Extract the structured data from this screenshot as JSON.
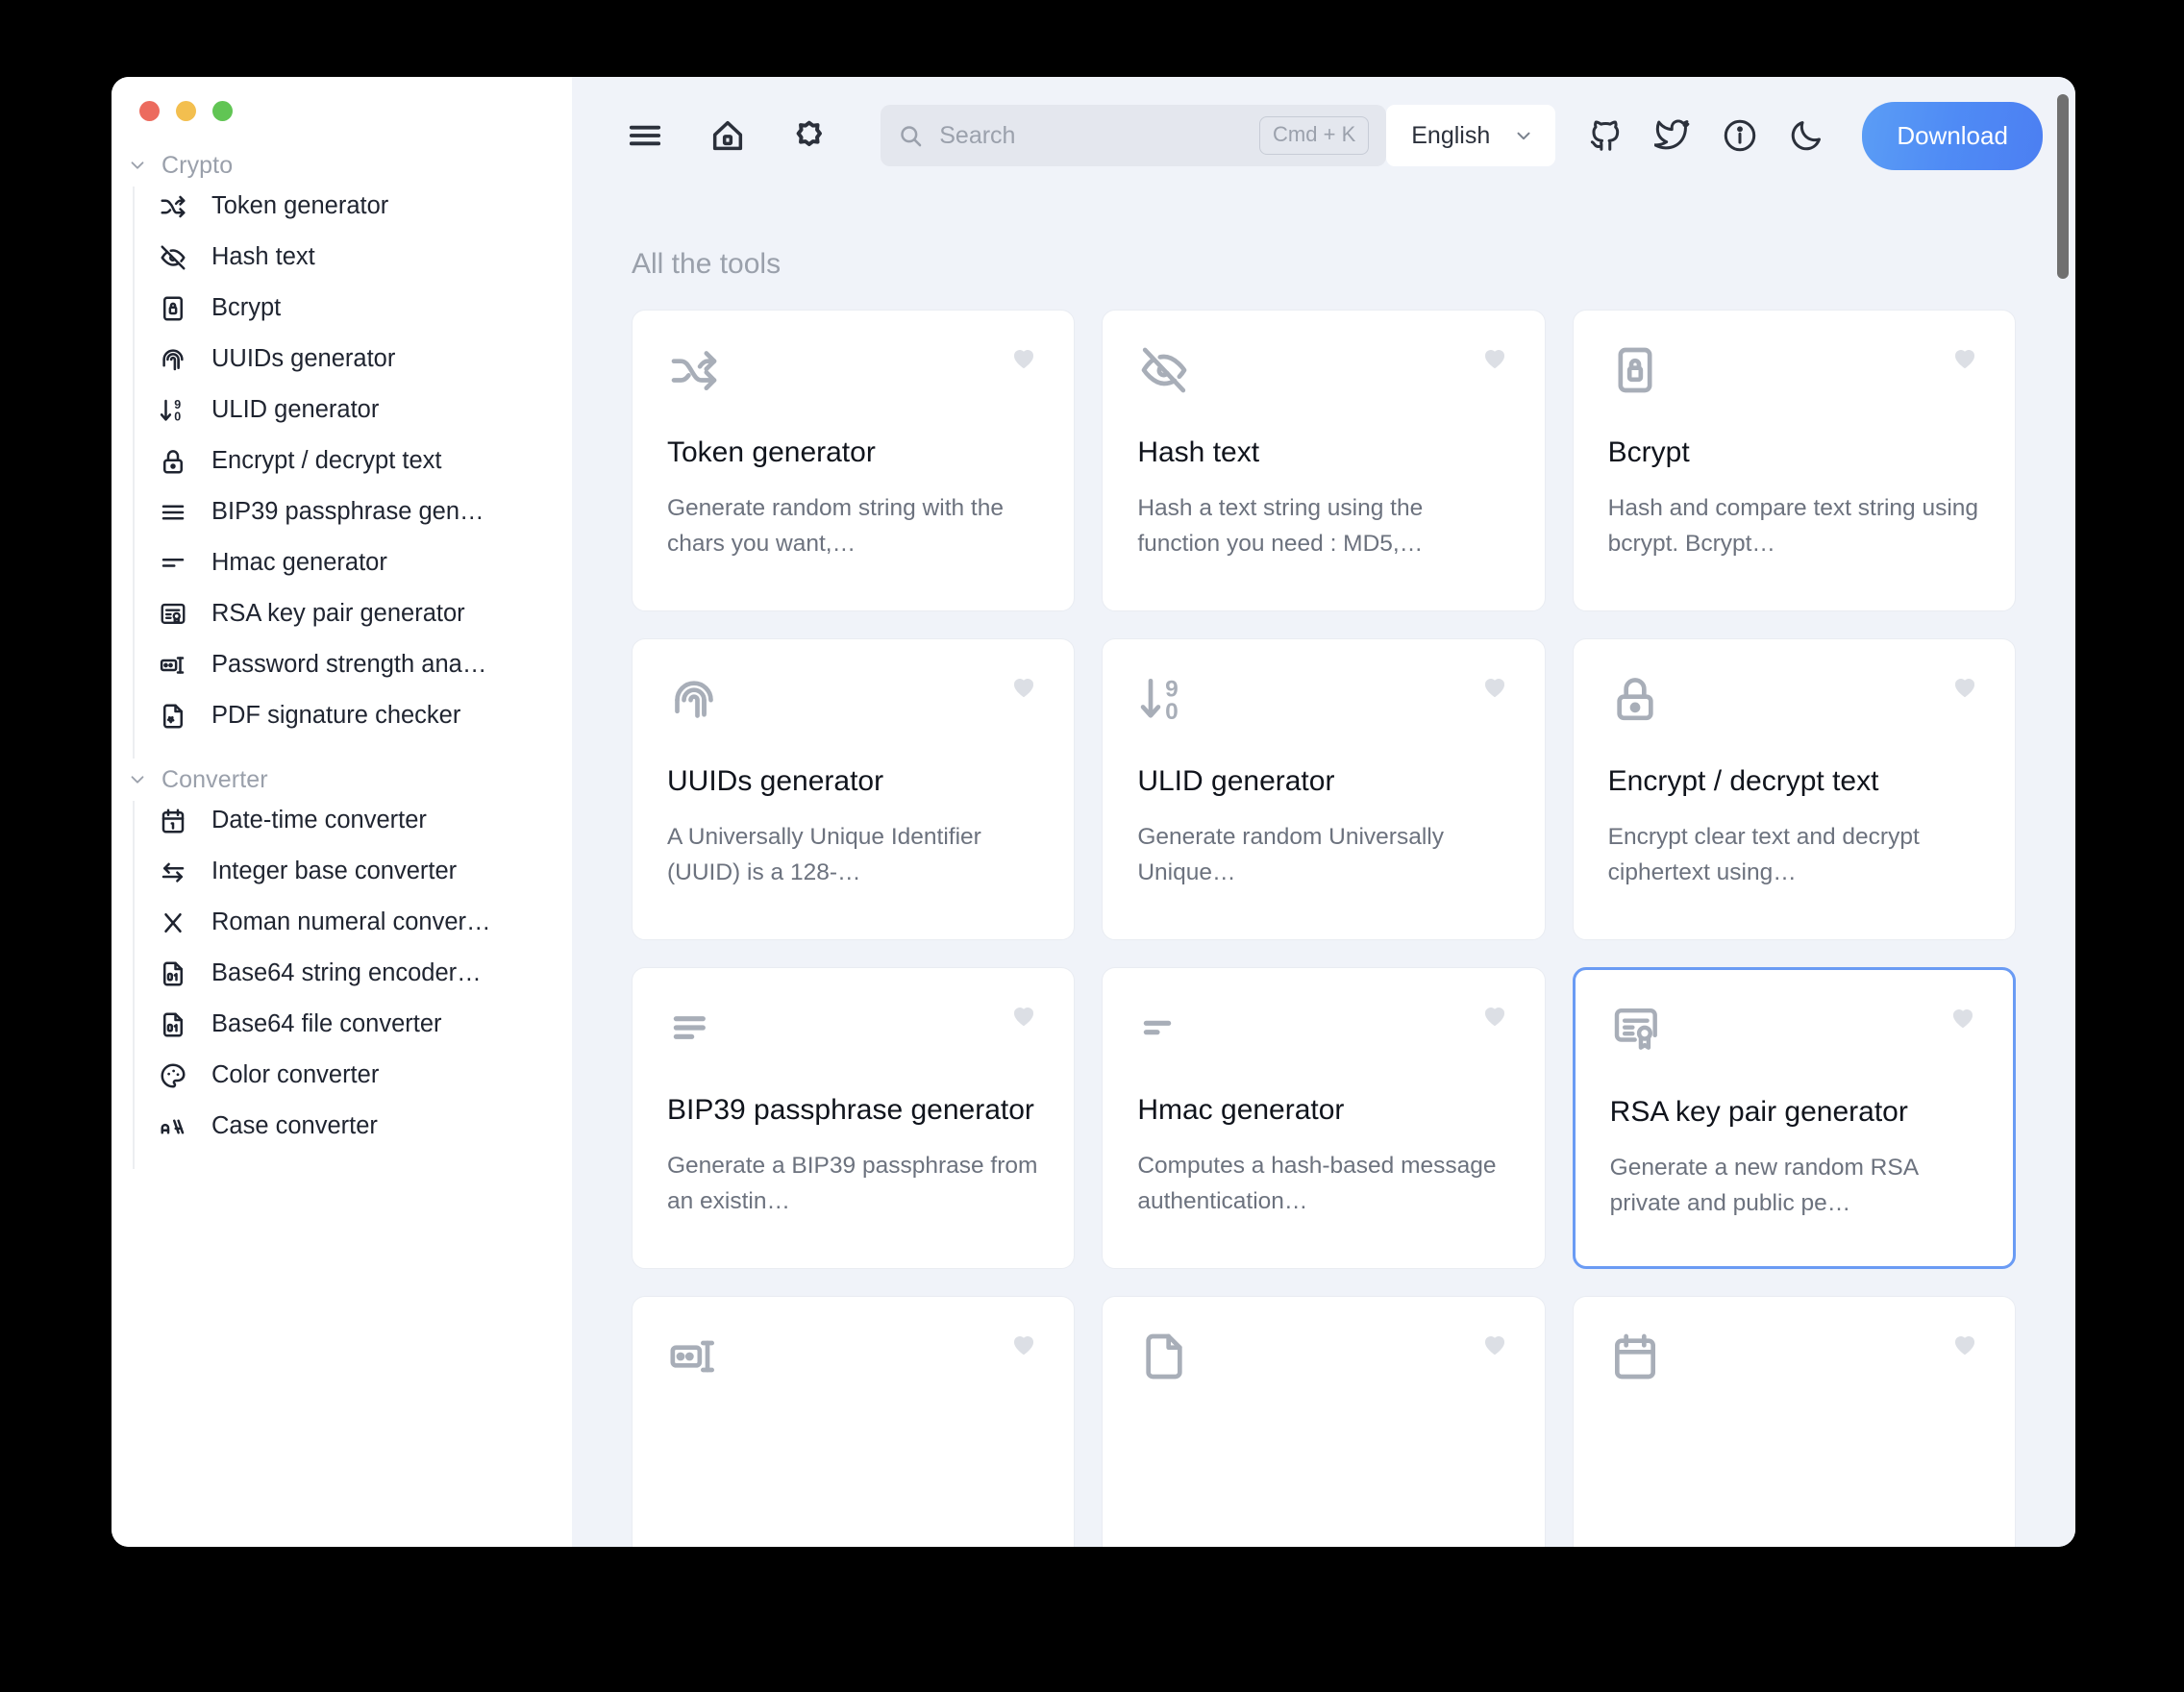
{
  "window": {
    "traffic_lights": [
      "close",
      "minimize",
      "maximize"
    ]
  },
  "sidebar": {
    "groups": [
      {
        "label": "Crypto",
        "items": [
          {
            "label": "Token generator",
            "icon": "shuffle-icon"
          },
          {
            "label": "Hash text",
            "icon": "eye-off-icon"
          },
          {
            "label": "Bcrypt",
            "icon": "lock-square-icon"
          },
          {
            "label": "UUIDs generator",
            "icon": "fingerprint-icon"
          },
          {
            "label": "ULID generator",
            "icon": "arrow-down-90-icon"
          },
          {
            "label": "Encrypt / decrypt text",
            "icon": "padlock-icon"
          },
          {
            "label": "BIP39 passphrase gen…",
            "icon": "lines-icon"
          },
          {
            "label": "Hmac generator",
            "icon": "two-lines-icon"
          },
          {
            "label": "RSA key pair generator",
            "icon": "certificate-icon"
          },
          {
            "label": "Password strength ana…",
            "icon": "password-icon"
          },
          {
            "label": "PDF signature checker",
            "icon": "file-badge-icon"
          }
        ]
      },
      {
        "label": "Converter",
        "items": [
          {
            "label": "Date-time converter",
            "icon": "calendar-icon"
          },
          {
            "label": "Integer base converter",
            "icon": "arrows-exchange-icon"
          },
          {
            "label": "Roman numeral conver…",
            "icon": "roman-x-icon"
          },
          {
            "label": "Base64 string encoder…",
            "icon": "file-binary-icon"
          },
          {
            "label": "Base64 file converter",
            "icon": "file-binary-icon"
          },
          {
            "label": "Color converter",
            "icon": "palette-icon"
          },
          {
            "label": "Case converter",
            "icon": "case-icon"
          }
        ]
      }
    ]
  },
  "topbar": {
    "menu_icon": "hamburger-menu-icon",
    "home_icon": "home-icon",
    "settings_icon": "spark-gear-icon",
    "search": {
      "icon": "search-icon",
      "placeholder": "Search",
      "shortcut": "Cmd + K"
    },
    "language": {
      "value": "English",
      "chevron": "chevron-down-icon"
    },
    "links": [
      {
        "name": "github-icon"
      },
      {
        "name": "twitter-icon"
      },
      {
        "name": "info-icon"
      },
      {
        "name": "moon-icon"
      }
    ],
    "download_label": "Download"
  },
  "main": {
    "section_title": "All the tools",
    "cards": [
      {
        "title": "Token generator",
        "desc": "Generate random string with the chars you want,…",
        "icon": "shuffle-icon",
        "favorite_icon": "heart-icon",
        "selected": false
      },
      {
        "title": "Hash text",
        "desc": "Hash a text string using the function you need : MD5,…",
        "icon": "eye-off-icon",
        "favorite_icon": "heart-icon",
        "selected": false
      },
      {
        "title": "Bcrypt",
        "desc": "Hash and compare text string using bcrypt. Bcrypt…",
        "icon": "lock-square-icon",
        "favorite_icon": "heart-icon",
        "selected": false
      },
      {
        "title": "UUIDs generator",
        "desc": "A Universally Unique Identifier (UUID) is a 128-…",
        "icon": "fingerprint-icon",
        "favorite_icon": "heart-icon",
        "selected": false
      },
      {
        "title": "ULID generator",
        "desc": "Generate random Universally Unique…",
        "icon": "arrow-down-90-icon",
        "favorite_icon": "heart-icon",
        "selected": false
      },
      {
        "title": "Encrypt / decrypt text",
        "desc": "Encrypt clear text and decrypt ciphertext using…",
        "icon": "padlock-icon",
        "favorite_icon": "heart-icon",
        "selected": false
      },
      {
        "title": "BIP39 passphrase generator",
        "desc": "Generate a BIP39 passphrase from an existin…",
        "icon": "lines-icon",
        "favorite_icon": "heart-icon",
        "selected": false
      },
      {
        "title": "Hmac generator",
        "desc": "Computes a hash-based message authentication…",
        "icon": "two-lines-icon",
        "favorite_icon": "heart-icon",
        "selected": false
      },
      {
        "title": "RSA key pair generator",
        "desc": "Generate a new random RSA private and public pe…",
        "icon": "certificate-icon",
        "favorite_icon": "heart-icon",
        "selected": true
      },
      {
        "title": "",
        "desc": "",
        "icon": "password-icon",
        "favorite_icon": "heart-icon",
        "selected": false
      },
      {
        "title": "",
        "desc": "",
        "icon": "file-icon",
        "favorite_icon": "heart-icon",
        "selected": false
      },
      {
        "title": "",
        "desc": "",
        "icon": "calendar-icon",
        "favorite_icon": "heart-icon",
        "selected": false
      }
    ]
  },
  "colors": {
    "accent": "#4f8bf5",
    "selected_border": "#6a9bf4",
    "main_bg": "#f0f3f9",
    "sidebar_bg": "#ffffff",
    "card_bg": "#ffffff",
    "muted_text": "#9aa0ab"
  }
}
